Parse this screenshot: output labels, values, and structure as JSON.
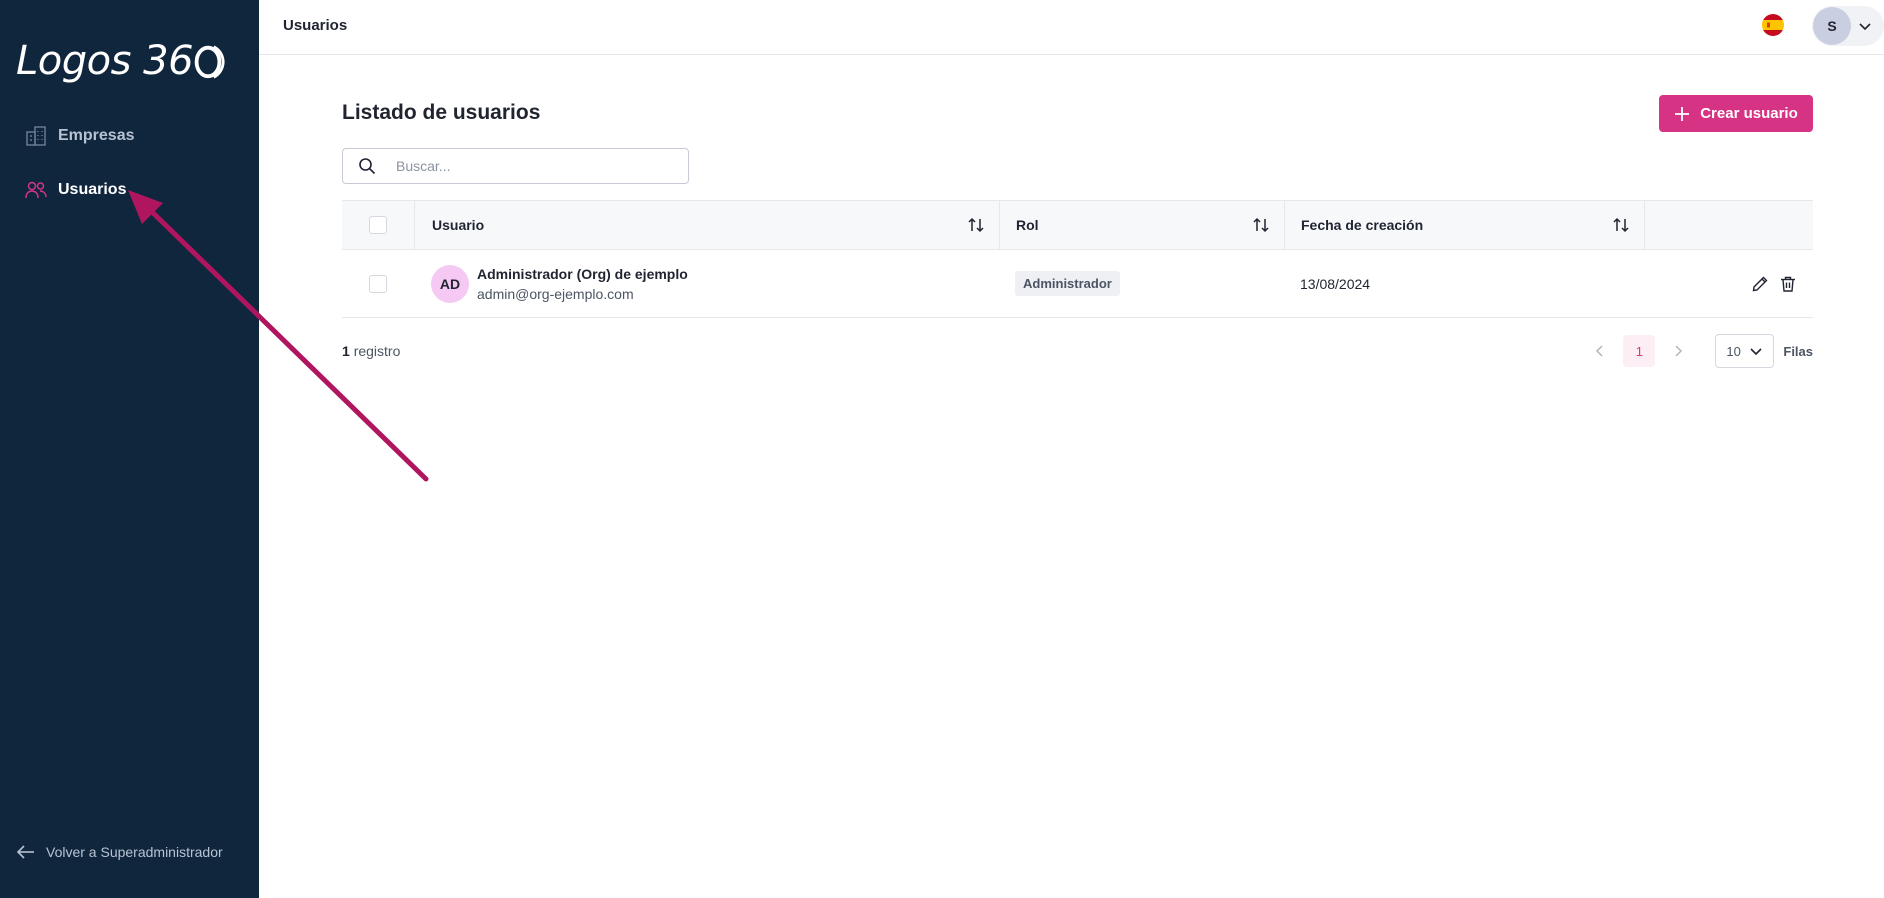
{
  "app": {
    "logo_text": "Logos 36"
  },
  "sidebar": {
    "items": [
      {
        "label": "Empresas",
        "icon": "building-icon"
      },
      {
        "label": "Usuarios",
        "icon": "users-icon",
        "active": true
      }
    ],
    "back_label": "Volver a Superadministrador"
  },
  "header": {
    "breadcrumb": "Usuarios",
    "language": "es",
    "user_initial": "S"
  },
  "main": {
    "title": "Listado de usuarios",
    "create_button": "Crear usuario",
    "search": {
      "placeholder": "Buscar...",
      "value": ""
    },
    "table": {
      "columns": [
        "Usuario",
        "Rol",
        "Fecha de creación"
      ],
      "rows": [
        {
          "initials": "AD",
          "name": "Administrador (Org) de ejemplo",
          "email": "admin@org-ejemplo.com",
          "role": "Administrador",
          "created": "13/08/2024"
        }
      ]
    },
    "footer": {
      "count": "1",
      "count_label": "registro",
      "current_page": "1",
      "rows_per_page": "10",
      "rows_label": "Filas"
    }
  },
  "colors": {
    "sidebar_bg": "#10263d",
    "accent": "#d63384",
    "annotation_arrow": "#b0155f"
  }
}
